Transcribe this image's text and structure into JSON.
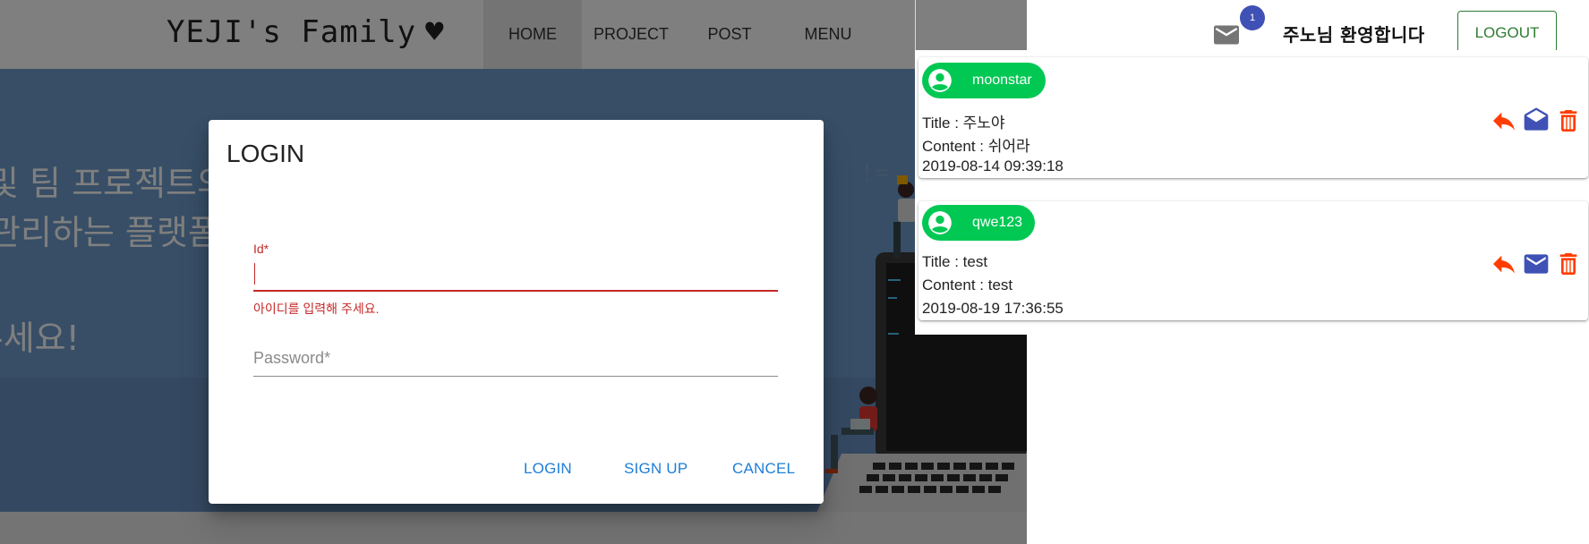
{
  "site": {
    "logo": "YEJI's Family",
    "nav": [
      "HOME",
      "PROJECT",
      "POST",
      "MENU"
    ],
    "hero_lines": [
      "및 팀 프로젝트의",
      "관리하는 플랫폼",
      "-세요!"
    ]
  },
  "dialog": {
    "title": "LOGIN",
    "id_label": "Id*",
    "id_value": "",
    "id_error": "아이디를 입력해 주세요.",
    "password_placeholder": "Password*",
    "buttons": {
      "login": "LOGIN",
      "signup": "SIGN UP",
      "cancel": "CANCEL"
    }
  },
  "header": {
    "mail_icon": "mail-icon",
    "badge_count": "1",
    "welcome": "주노님 환영합니다",
    "logout": "LOGOUT"
  },
  "messages": [
    {
      "sender": "moonstar",
      "title_label": "Title : ",
      "title": "주노야",
      "content_label": "Content : ",
      "content": "쉬어라",
      "date": "2019-08-14 09:39:18",
      "read": true
    },
    {
      "sender": "qwe123",
      "title_label": "Title : ",
      "title": "test",
      "content_label": "Content : ",
      "content": "test",
      "date": "2019-08-19 17:36:55",
      "read": false
    }
  ],
  "colors": {
    "chip": "#00c853",
    "reply_icon": "#ff3d00",
    "mail_action_icon": "#3f51b5",
    "delete_icon": "#ff3d00",
    "error": "#c62828",
    "dialog_button": "#1e7ed6",
    "logout": "#2e7d32"
  }
}
